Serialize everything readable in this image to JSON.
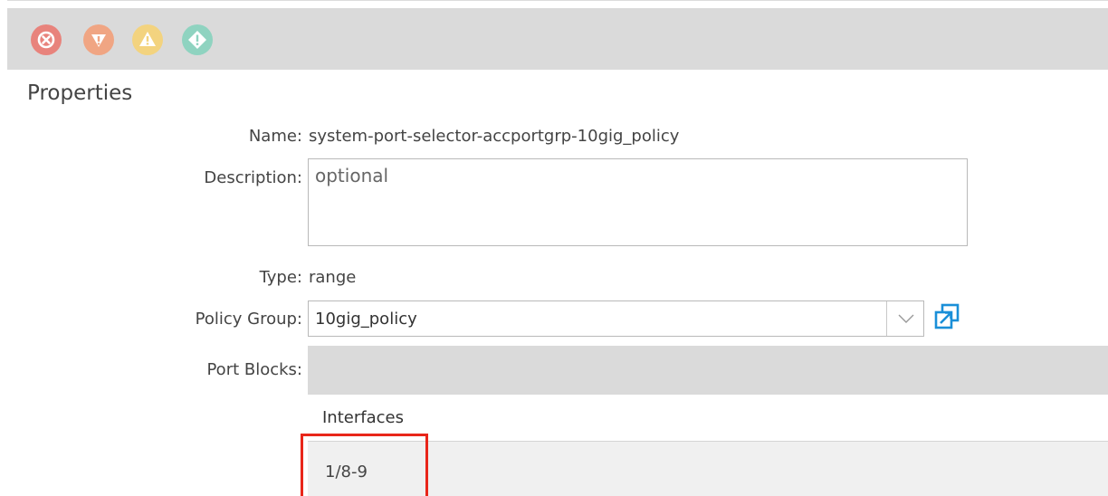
{
  "fault_toolbar": {
    "icons": [
      "critical-fault-icon",
      "major-fault-icon",
      "minor-fault-icon",
      "warning-fault-icon"
    ],
    "colors": {
      "critical": "#e8837c",
      "major": "#f0a583",
      "minor": "#f3d37f",
      "warning": "#8fd3c0"
    }
  },
  "properties": {
    "title": "Properties",
    "name_label": "Name:",
    "name_value": "system-port-selector-accportgrp-10gig_policy",
    "description_label": "Description:",
    "description_placeholder": "optional",
    "description_value": "",
    "type_label": "Type:",
    "type_value": "range",
    "policy_group_label": "Policy Group:",
    "policy_group_value": "10gig_policy",
    "port_blocks_label": "Port Blocks:"
  },
  "port_blocks_table": {
    "columns": [
      "Interfaces"
    ],
    "rows": [
      {
        "interfaces": "1/8-9"
      }
    ]
  },
  "accent": {
    "highlight": "#e8261a",
    "open_icon": "#1a8fd8"
  }
}
